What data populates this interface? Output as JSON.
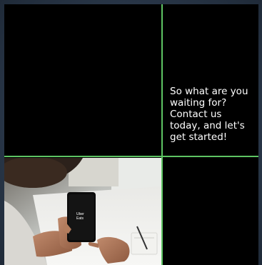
{
  "cta": {
    "line1": "So what are you",
    "line2": "waiting for?",
    "line3": "Contact us",
    "line4": "today, and let's",
    "line5": "get started!"
  },
  "photo": {
    "phone_logo_line1": "Uber",
    "phone_logo_line2": "Eats"
  },
  "colors": {
    "grid_lines": "#5ec463",
    "cell_background": "#000000",
    "page_background": "#2b3a4d"
  }
}
